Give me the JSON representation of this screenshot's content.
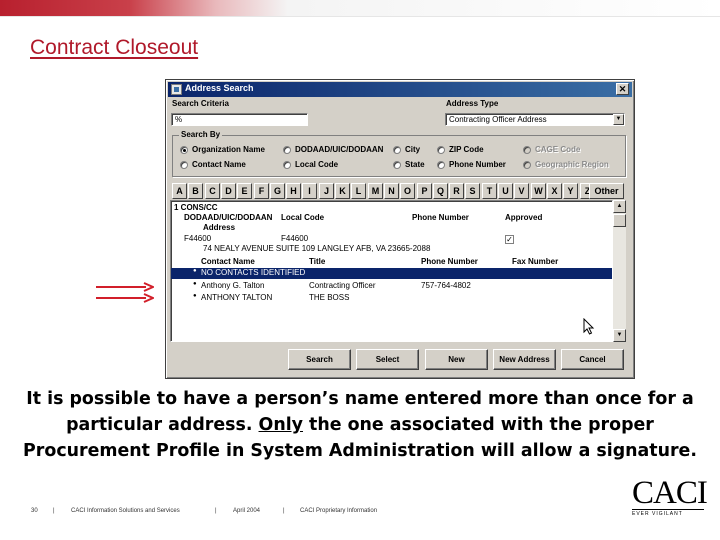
{
  "slide": {
    "title": "Contract Closeout",
    "caption_part1": "It is possible to have a person’s name entered more than once for a particular address.  ",
    "caption_underlined": "Only",
    "caption_part2": " the one associated with the proper Procurement Profile in System Administration will allow a signature.",
    "accent_color": "#b0192a"
  },
  "dialog": {
    "title": "Address Search",
    "close_glyph": "✕",
    "search_criteria_label": "Search Criteria",
    "search_criteria_value": "%",
    "address_type_label": "Address Type",
    "address_type_value": "Contracting Officer Address",
    "search_by_label": "Search By",
    "radios": [
      {
        "label": "Organization Name",
        "selected": true,
        "enabled": true
      },
      {
        "label": "DODAAD/UIC/DODAAN",
        "selected": false,
        "enabled": true
      },
      {
        "label": "City",
        "selected": false,
        "enabled": true
      },
      {
        "label": "ZIP Code",
        "selected": false,
        "enabled": true
      },
      {
        "label": "CAGE Code",
        "selected": false,
        "enabled": false
      },
      {
        "label": "Contact Name",
        "selected": false,
        "enabled": true
      },
      {
        "label": "Local Code",
        "selected": false,
        "enabled": true
      },
      {
        "label": "State",
        "selected": false,
        "enabled": true
      },
      {
        "label": "Phone Number",
        "selected": false,
        "enabled": true
      },
      {
        "label": "Geographic Region",
        "selected": false,
        "enabled": false
      }
    ],
    "letters": [
      "A",
      "B",
      "C",
      "D",
      "E",
      "F",
      "G",
      "H",
      "I",
      "J",
      "K",
      "L",
      "M",
      "N",
      "O",
      "P",
      "Q",
      "R",
      "S",
      "T",
      "U",
      "V",
      "W",
      "X",
      "Y",
      "Z"
    ],
    "other_label": "Other",
    "results": {
      "group_title": "1 CONS/CC",
      "addr_headers": {
        "code": "DODAAD/UIC/DODAAN",
        "local": "Local Code",
        "phone": "Phone Number",
        "approved": "Approved",
        "address": "Address"
      },
      "addr_row": {
        "code": "F44600",
        "local": "F44600",
        "approved_mark": "✓",
        "address": "74 NEALY AVENUE SUITE 109  LANGLEY AFB, VA  23665-2088"
      },
      "contact_headers": {
        "name": "Contact Name",
        "title": "Title",
        "phone": "Phone Number",
        "fax": "Fax Number"
      },
      "contacts": [
        {
          "name": "NO CONTACTS IDENTIFIED",
          "title": "",
          "phone": "",
          "fax": "",
          "selected": true
        },
        {
          "name": "Anthony G. Talton",
          "title": "Contracting Officer",
          "phone": "757-764-4802",
          "fax": "",
          "selected": false
        },
        {
          "name": "ANTHONY TALTON",
          "title": "THE BOSS",
          "phone": "",
          "fax": "",
          "selected": false
        }
      ],
      "bullet": "●"
    },
    "buttons": {
      "search": "Search",
      "select": "Select",
      "new": "New",
      "new_address": "New Address",
      "cancel": "Cancel"
    }
  },
  "footer": {
    "page": "30",
    "sep": "|",
    "company": "CACI Information Solutions and Services",
    "date": "April 2004",
    "notice": "CACI Proprietary Information"
  },
  "logo": {
    "mark": "CACI",
    "tagline": "EVER VIGILANT"
  },
  "colors": {
    "arrow": "#d21f2a",
    "selection": "#0a246a",
    "dialog_bg": "#d4d0c8"
  }
}
